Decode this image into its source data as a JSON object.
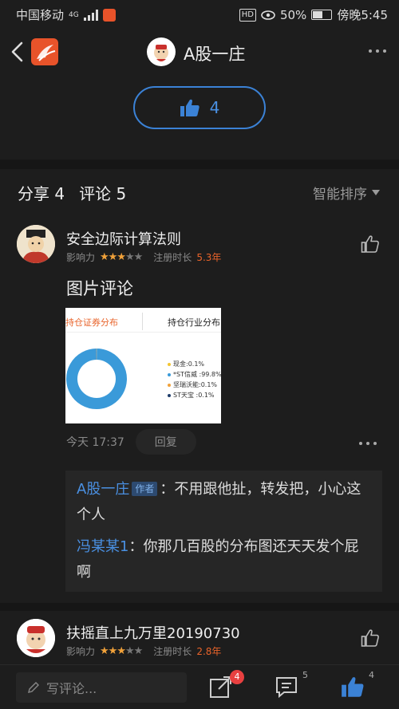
{
  "statusbar": {
    "carrier": "中国移动",
    "network": "4G",
    "battery": "50%",
    "time": "傍晚5:45",
    "hd": "HD"
  },
  "header": {
    "title": "A股一庄"
  },
  "like_button": {
    "count": "4"
  },
  "tabs": {
    "share": "分享 4",
    "comments": "评论 5",
    "sort": "智能排序"
  },
  "comments": [
    {
      "username": "安全边际计算法则",
      "influence_label": "影响力",
      "stars_on": "★★★",
      "stars_off": "★★",
      "reg_label": "注册时长",
      "reg_value": "5.3年",
      "text": "图片评论",
      "time": "今天 17:37",
      "reply_label": "回复",
      "image": {
        "tab1": "持仓证券分布",
        "tab2": "持仓行业分布",
        "legend": [
          {
            "label": "现金:0.1%",
            "color": "#f4c531"
          },
          {
            "label": "*ST信威 :99.8%",
            "color": "#3a9ad9"
          },
          {
            "label": "坚瑞沃能:0.1%",
            "color": "#f0a13a"
          },
          {
            "label": "ST天宝 :0.1%",
            "color": "#1f3d6b"
          }
        ]
      },
      "replies": [
        {
          "who": "A股一庄",
          "badge": "作者",
          "text": "：不用跟他扯，转发把，小心这个人"
        },
        {
          "who": "冯某某1",
          "text": "：你那几百股的分布图还天天发个屁啊"
        }
      ]
    },
    {
      "username": "扶摇直上九万里20190730",
      "influence_label": "影响力",
      "stars_on": "★★★",
      "stars_off": "★★",
      "reg_label": "注册时长",
      "reg_value": "2.8年"
    }
  ],
  "bottombar": {
    "placeholder": "写评论...",
    "forward_count": "4",
    "comment_count": "5",
    "like_count": "4"
  },
  "chart_data": {
    "type": "pie",
    "categories": [
      "现金",
      "*ST信威",
      "坚瑞沃能",
      "ST天宝"
    ],
    "values": [
      0.1,
      99.8,
      0.1,
      0.1
    ]
  }
}
